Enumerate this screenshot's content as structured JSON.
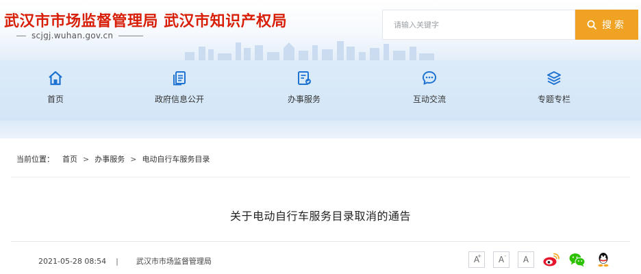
{
  "header": {
    "site_title": "武汉市市场监督管理局 武汉市知识产权局",
    "domain": "scjgj.wuhan.gov.cn",
    "search_placeholder": "请输入关键字",
    "search_button_label": "搜索"
  },
  "nav": {
    "items": [
      {
        "label": "首页",
        "icon": "home-icon"
      },
      {
        "label": "政府信息公开",
        "icon": "document-icon"
      },
      {
        "label": "办事服务",
        "icon": "form-icon"
      },
      {
        "label": "互动交流",
        "icon": "chat-icon"
      },
      {
        "label": "专题专栏",
        "icon": "layers-icon"
      }
    ]
  },
  "breadcrumb": {
    "label": "当前位置：",
    "items": [
      "首页",
      "办事服务",
      "电动自行车服务目录"
    ],
    "separator": ">"
  },
  "article": {
    "title": "关于电动自行车服务目录取消的通告",
    "date": "2021-05-28 08:54",
    "divider": "|",
    "source": "武汉市市场监督管理局"
  },
  "tools": {
    "font_large": "A",
    "font_large_sup": "+",
    "font_medium": "A",
    "font_medium_sup": "-",
    "font_default": "A",
    "share": [
      "weibo-icon",
      "wechat-icon",
      "qq-icon"
    ]
  },
  "colors": {
    "brand_red": "#d81e06",
    "accent_orange": "#f0a222",
    "nav_icon_blue": "#1e73d2"
  }
}
